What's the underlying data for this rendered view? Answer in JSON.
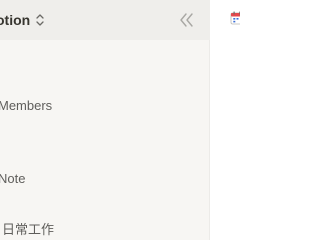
{
  "sidebar": {
    "workspace": {
      "name": "otion",
      "switcher_icon": "chevron-up-down-icon"
    },
    "collapse_icon": "double-chevron-left-icon",
    "items": [
      {
        "label": "Members"
      },
      {
        "label": "Note"
      },
      {
        "label": "日常工作"
      }
    ]
  },
  "main": {
    "page_icon": "calendar-icon"
  },
  "colors": {
    "sidebar_bg": "#f7f6f3",
    "header_bg": "#efeeeb",
    "text_primary": "#37352f",
    "text_secondary": "#5f5e5b",
    "icon_gray": "#a8a7a3",
    "calendar_red": "#e5484d",
    "calendar_blue": "#3b6fd8"
  }
}
